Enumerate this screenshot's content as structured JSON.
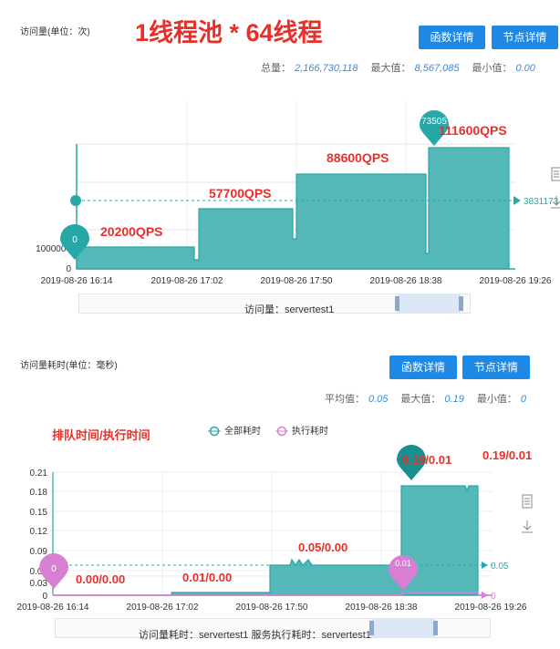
{
  "panel1": {
    "title": "访问量(单位：次)",
    "big_title": "1线程池 * 64线程",
    "buttons": {
      "func": "函数详情",
      "node": "节点详情"
    },
    "stats": {
      "total_label": "总量：",
      "total_value": "2,166,730,118",
      "max_label": "最大值：",
      "max_value": "8,567,085",
      "min_label": "最小值：",
      "min_value": "0.00"
    },
    "y_ticks": [
      "1000000",
      "0"
    ],
    "x_ticks": [
      "2019-08-26 16:14",
      "2019-08-26 17:02",
      "2019-08-26 17:50",
      "2019-08-26 18:38",
      "2019-08-26 19:26"
    ],
    "markers": {
      "left": "0",
      "top": "73505"
    },
    "avg_value": "3831173",
    "annotations": [
      "20200QPS",
      "57700QPS",
      "88600QPS",
      "111600QPS"
    ],
    "nav_label": "访问量：servertest1"
  },
  "panel2": {
    "title": "访问量耗时(单位：毫秒)",
    "buttons": {
      "func": "函数详情",
      "node": "节点详情"
    },
    "stats": {
      "avg_label": "平均值：",
      "avg_value": "0.05",
      "max_label": "最大值：",
      "max_value": "0.19",
      "min_label": "最小值：",
      "min_value": "0"
    },
    "subtitle": "排队时间/执行时间",
    "legend": [
      "全部耗时",
      "执行耗时"
    ],
    "y_ticks": [
      "0.21",
      "0.18",
      "0.15",
      "0.12",
      "0.09",
      "0.06",
      "0.03",
      "0"
    ],
    "x_ticks": [
      "2019-08-26 16:14",
      "2019-08-26 17:02",
      "2019-08-26 17:50",
      "2019-08-26 18:38",
      "2019-08-26 19:26"
    ],
    "markers": {
      "left": "0",
      "mid": "0.01"
    },
    "right_values": {
      "total": "0.05",
      "exec": "0"
    },
    "annotations": [
      "0.00/0.00",
      "0.01/0.00",
      "0.05/0.00",
      "0.19/0.01",
      "0.19/0.01"
    ],
    "nav_label": "访问量耗时：servertest1 服务执行耗时：servertest1"
  },
  "colors": {
    "teal": "#27a7a7",
    "fill": "#55b8b8",
    "red": "#e8302a",
    "purple": "#d77fd3",
    "blue_btn": "#1e88e5"
  },
  "chart_data": [
    {
      "type": "area",
      "x": [
        "2019-08-26 16:14",
        "2019-08-26 17:02",
        "2019-08-26 17:50",
        "2019-08-26 18:38",
        "2019-08-26 19:26"
      ],
      "series": [
        {
          "values_qps_levels": [
            20200,
            57700,
            88600,
            111600
          ]
        }
      ]
    },
    {
      "type": "area",
      "x": [
        "2019-08-26 16:14",
        "2019-08-26 17:02",
        "2019-08-26 17:50",
        "2019-08-26 18:38",
        "2019-08-26 19:26"
      ],
      "series": [
        {
          "name": "全部耗时",
          "levels": [
            0.0,
            0.01,
            0.05,
            0.19
          ]
        },
        {
          "name": "执行耗时",
          "levels": [
            0.0,
            0.0,
            0.0,
            0.01
          ]
        }
      ]
    }
  ]
}
